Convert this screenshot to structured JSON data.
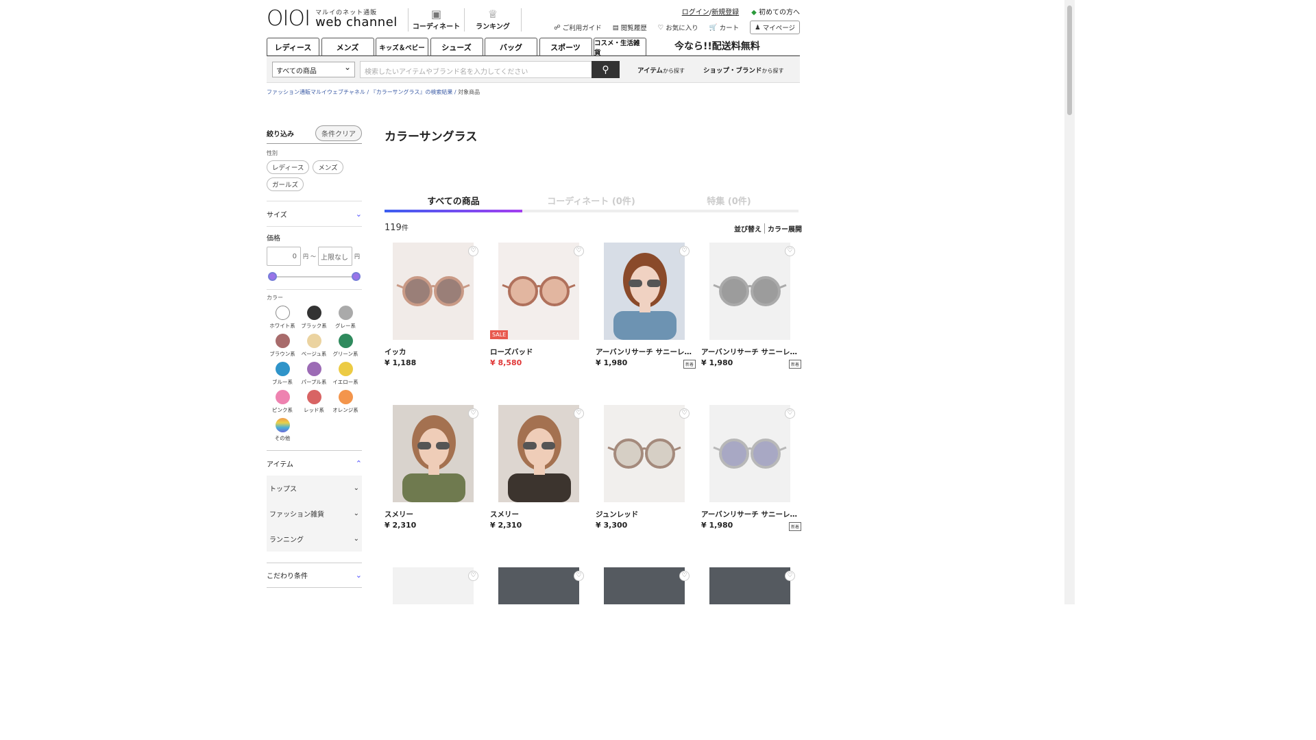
{
  "header": {
    "logo_mark": "OIOI",
    "logo_sub": "マルイのネット通販",
    "logo_main": "web channel",
    "nav": [
      {
        "label": "コーディネート",
        "icon": "camera-icon"
      },
      {
        "label": "ランキング",
        "icon": "crown-icon"
      }
    ],
    "login": "ログイン",
    "register": "新規登録",
    "first_time": "初めての方へ",
    "utils": [
      "ご利用ガイド",
      "閲覧履歴",
      "お気に入り",
      "カート"
    ],
    "mypage": "マイページ"
  },
  "categories": [
    "レディース",
    "メンズ",
    "キッズ＆ベビー",
    "シューズ",
    "バッグ",
    "スポーツ",
    "コスメ・生活雑貨"
  ],
  "promo": "今なら!!配送料無料",
  "search": {
    "select_value": "すべての商品",
    "placeholder": "検索したいアイテムやブランド名を入力してください",
    "link_item": "アイテム",
    "link_item_suffix": "から探す",
    "link_shop": "ショップ・ブランド",
    "link_shop_suffix": "から探す"
  },
  "breadcrumb": [
    "ファッション通販マルイウェブチャネル",
    "『カラーサングラス』の検索結果",
    "対象商品"
  ],
  "sidebar": {
    "title": "絞り込み",
    "clear": "条件クリア",
    "gender_label": "性別",
    "genders": [
      "レディース",
      "メンズ",
      "ガールズ"
    ],
    "size": "サイズ",
    "price_label": "価格",
    "price_min": "0",
    "price_max": "上限なし",
    "yen": "円",
    "tilde": "〜",
    "color_label": "カラー",
    "colors": [
      {
        "name": "ホワイト系",
        "hex": "#ffffff"
      },
      {
        "name": "ブラック系",
        "hex": "#333333"
      },
      {
        "name": "グレー系",
        "hex": "#aaaaaa"
      },
      {
        "name": "ブラウン系",
        "hex": "#a86b6b"
      },
      {
        "name": "ベージュ系",
        "hex": "#ebd3a0"
      },
      {
        "name": "グリーン系",
        "hex": "#2f8a5d"
      },
      {
        "name": "ブルー系",
        "hex": "#2f94c9"
      },
      {
        "name": "パープル系",
        "hex": "#9c6bb5"
      },
      {
        "name": "イエロー系",
        "hex": "#eccb44"
      },
      {
        "name": "ピンク系",
        "hex": "#ee82b0"
      },
      {
        "name": "レッド系",
        "hex": "#d86464"
      },
      {
        "name": "オレンジ系",
        "hex": "#f3954c"
      },
      {
        "name": "その他",
        "hex": "gradient"
      }
    ],
    "item": "アイテム",
    "sub_items": [
      "トップス",
      "ファッション雑貨",
      "ランニング"
    ],
    "kodawari": "こだわり条件"
  },
  "main": {
    "title": "カラーサングラス",
    "tabs": [
      "すべての商品",
      "コーディネート (0件)",
      "特集 (0件)"
    ],
    "count": "119",
    "count_unit": "件",
    "sort": "並び替え",
    "color_expand": "カラー展開"
  },
  "products": [
    {
      "name": "イッカ",
      "price": "¥ 1,188",
      "sale": false,
      "new": false,
      "img": "pink-round"
    },
    {
      "name": "ローズバッド",
      "price": "¥ 8,580",
      "sale": true,
      "new": false,
      "img": "tan-round"
    },
    {
      "name": "アーバンリサーチ サニーレーベル",
      "price": "¥ 1,980",
      "sale": false,
      "new": true,
      "img": "model-1"
    },
    {
      "name": "アーバンリサーチ サニーレーベル",
      "price": "¥ 1,980",
      "sale": false,
      "new": true,
      "img": "silver-round"
    },
    {
      "name": "スメリー",
      "price": "¥ 2,310",
      "sale": false,
      "new": false,
      "img": "model-2"
    },
    {
      "name": "スメリー",
      "price": "¥ 2,310",
      "sale": false,
      "new": false,
      "img": "model-3"
    },
    {
      "name": "ジュンレッド",
      "price": "¥ 3,300",
      "sale": false,
      "new": false,
      "img": "beige-round"
    },
    {
      "name": "アーバンリサーチ サニーレーベル",
      "price": "¥ 1,980",
      "sale": false,
      "new": true,
      "img": "silver-lavender"
    }
  ],
  "sale_label": "SALE",
  "new_label": "新着"
}
